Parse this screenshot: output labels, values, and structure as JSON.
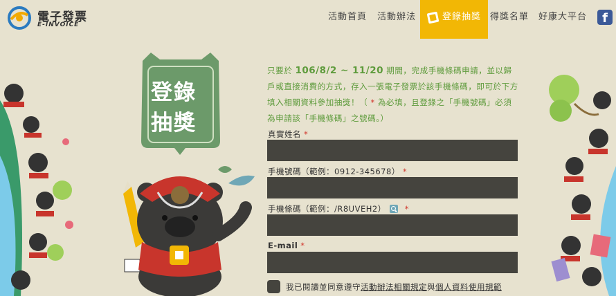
{
  "brand": {
    "title": "電子發票",
    "subtitle": "E-INVOICE"
  },
  "nav": {
    "items": [
      {
        "label": "活動首頁"
      },
      {
        "label": "活動辦法"
      },
      {
        "label": "登錄抽獎"
      },
      {
        "label": "得獎名單"
      },
      {
        "label": "好康大平台"
      }
    ],
    "active_index": 2,
    "facebook_icon": "facebook-icon"
  },
  "badge": {
    "line1": "登錄",
    "line2": "抽獎"
  },
  "intro": {
    "p1": "只要於",
    "dates": "106/8/2 ~ 11/20",
    "p2": "期間，完成手機條碼申請，並以歸戶或直接消費的方式，存入一張電子發票於該手機條碼，即可於下方填入相關資料參加抽獎！（",
    "star": "*",
    "p3": "為必填，且登錄之「手機號碼」必須為申請該「手機條碼」之號碼。）"
  },
  "form": {
    "name_label": "真實姓名",
    "phone_label": "手機號碼（範例：0912-345678）",
    "barcode_label": "手機條碼（範例：/R8UVEH2）",
    "email_label": "E-mail",
    "required_mark": "*",
    "agree_prefix": "我已閱讀並同意遵守",
    "agree_link1": "活動辦法相關規定",
    "agree_mid": "與",
    "agree_link2": "個人資料使用規範"
  },
  "colors": {
    "background": "#e7e2cf",
    "accent": "#f2b705",
    "badge": "#6c9a6a",
    "field": "#45443e",
    "required": "#d1342a"
  }
}
